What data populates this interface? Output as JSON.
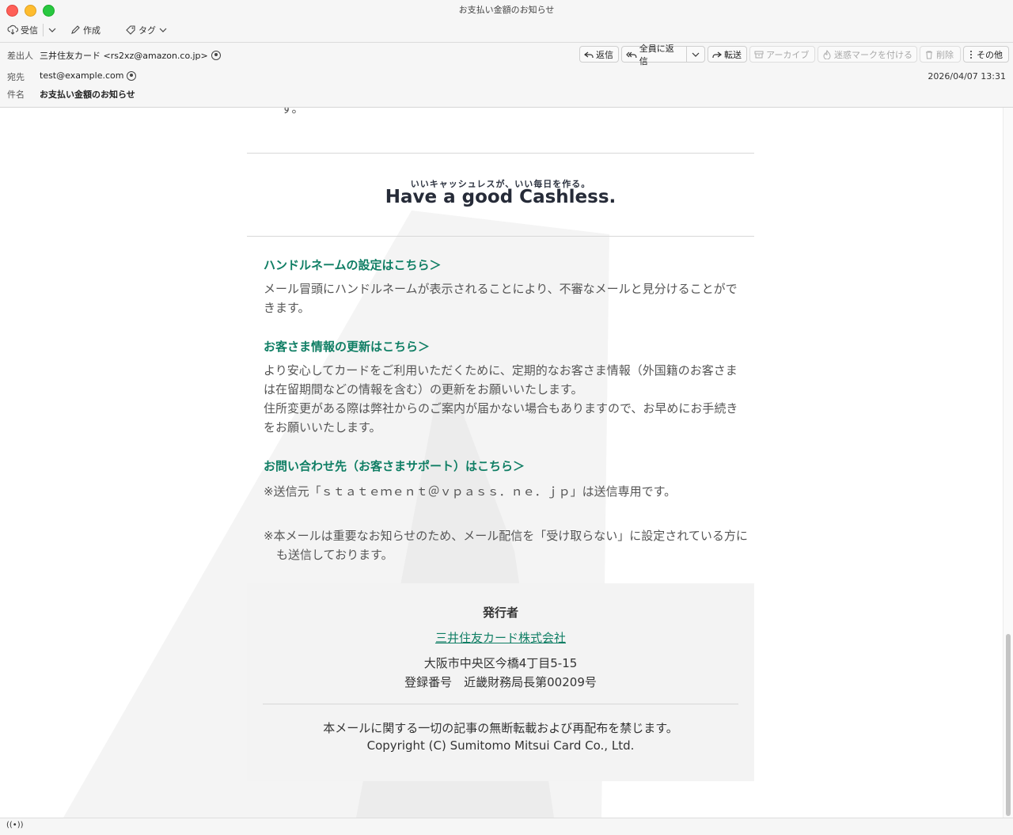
{
  "window": {
    "title": "お支払い金額のお知らせ"
  },
  "toolbar": {
    "receive_label": "受信",
    "compose_label": "作成",
    "tag_label": "タグ"
  },
  "header": {
    "from_label": "差出人",
    "from_value": "三井住友カード <rs2xz@amazon.co.jp>",
    "to_label": "宛先",
    "to_value": "test@example.com",
    "subject_label": "件名",
    "subject_value": "お支払い金額のお知らせ",
    "date": "2026/04/07 13:31"
  },
  "actions": {
    "reply": "返信",
    "reply_all": "全員に返信",
    "forward": "転送",
    "archive": "アーカイブ",
    "junk": "迷惑マークを付ける",
    "delete": "削除",
    "more": "その他"
  },
  "message": {
    "truncated_top": "す。",
    "banner_sub": "いいキャッシュレスが、いい毎日を作る。",
    "banner_main": "Have a good Cashless.",
    "sections": [
      {
        "title": "ハンドルネームの設定はこちら＞",
        "body": "メール冒頭にハンドルネームが表示されることにより、不審なメールと見分けることができます。"
      },
      {
        "title": "お客さま情報の更新はこちら＞",
        "body1": "より安心してカードをご利用いただくために、定期的なお客さま情報（外国籍のお客さまは在留期間などの情報を含む）の更新をお願いいたします。",
        "body2": "住所変更がある際は弊社からのご案内が届かない場合もありますので、お早めにお手続きをお願いいたします。"
      },
      {
        "title": "お問い合わせ先（お客さまサポート）はこちら＞"
      }
    ],
    "note1": "※送信元「ｓｔａｔｅｍｅｎｔ＠ｖｐａｓｓ．ｎｅ．ｊｐ」は送信専用です。",
    "note2": "※本メールは重要なお知らせのため、メール配信を「受け取らない」に設定されている方にも送信しております。"
  },
  "footer": {
    "publisher_label": "発行者",
    "company_link": "三井住友カード株式会社",
    "address": "大阪市中央区今橋4丁目5-15",
    "registration": "登録番号　近畿財務局長第00209号",
    "disclaimer": "本メールに関する一切の記事の無断転載および再配布を禁じます。",
    "copyright": "Copyright (C) Sumitomo Mitsui Card Co., Ltd."
  },
  "colors": {
    "accent": "#0f7e64",
    "footer_bg": "#f3f3f3",
    "mountain": "#f4f4f4"
  }
}
